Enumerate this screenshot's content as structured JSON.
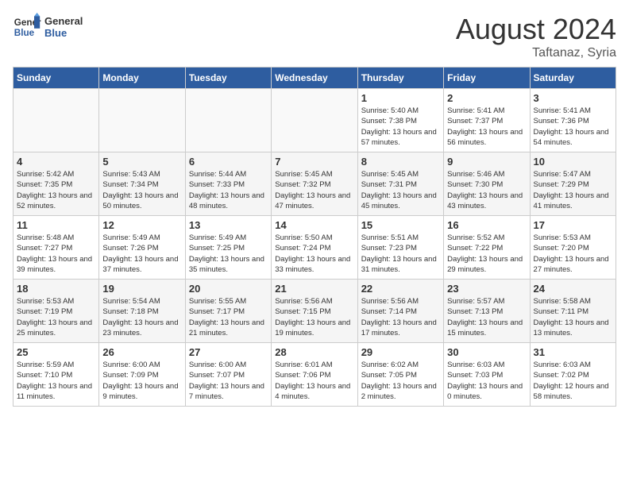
{
  "header": {
    "logo_line1": "General",
    "logo_line2": "Blue",
    "month_year": "August 2024",
    "location": "Taftanaz, Syria"
  },
  "weekdays": [
    "Sunday",
    "Monday",
    "Tuesday",
    "Wednesday",
    "Thursday",
    "Friday",
    "Saturday"
  ],
  "weeks": [
    [
      {
        "day": "",
        "empty": true
      },
      {
        "day": "",
        "empty": true
      },
      {
        "day": "",
        "empty": true
      },
      {
        "day": "",
        "empty": true
      },
      {
        "day": "1",
        "sunrise": "Sunrise: 5:40 AM",
        "sunset": "Sunset: 7:38 PM",
        "daylight": "Daylight: 13 hours and 57 minutes."
      },
      {
        "day": "2",
        "sunrise": "Sunrise: 5:41 AM",
        "sunset": "Sunset: 7:37 PM",
        "daylight": "Daylight: 13 hours and 56 minutes."
      },
      {
        "day": "3",
        "sunrise": "Sunrise: 5:41 AM",
        "sunset": "Sunset: 7:36 PM",
        "daylight": "Daylight: 13 hours and 54 minutes."
      }
    ],
    [
      {
        "day": "4",
        "sunrise": "Sunrise: 5:42 AM",
        "sunset": "Sunset: 7:35 PM",
        "daylight": "Daylight: 13 hours and 52 minutes."
      },
      {
        "day": "5",
        "sunrise": "Sunrise: 5:43 AM",
        "sunset": "Sunset: 7:34 PM",
        "daylight": "Daylight: 13 hours and 50 minutes."
      },
      {
        "day": "6",
        "sunrise": "Sunrise: 5:44 AM",
        "sunset": "Sunset: 7:33 PM",
        "daylight": "Daylight: 13 hours and 48 minutes."
      },
      {
        "day": "7",
        "sunrise": "Sunrise: 5:45 AM",
        "sunset": "Sunset: 7:32 PM",
        "daylight": "Daylight: 13 hours and 47 minutes."
      },
      {
        "day": "8",
        "sunrise": "Sunrise: 5:45 AM",
        "sunset": "Sunset: 7:31 PM",
        "daylight": "Daylight: 13 hours and 45 minutes."
      },
      {
        "day": "9",
        "sunrise": "Sunrise: 5:46 AM",
        "sunset": "Sunset: 7:30 PM",
        "daylight": "Daylight: 13 hours and 43 minutes."
      },
      {
        "day": "10",
        "sunrise": "Sunrise: 5:47 AM",
        "sunset": "Sunset: 7:29 PM",
        "daylight": "Daylight: 13 hours and 41 minutes."
      }
    ],
    [
      {
        "day": "11",
        "sunrise": "Sunrise: 5:48 AM",
        "sunset": "Sunset: 7:27 PM",
        "daylight": "Daylight: 13 hours and 39 minutes."
      },
      {
        "day": "12",
        "sunrise": "Sunrise: 5:49 AM",
        "sunset": "Sunset: 7:26 PM",
        "daylight": "Daylight: 13 hours and 37 minutes."
      },
      {
        "day": "13",
        "sunrise": "Sunrise: 5:49 AM",
        "sunset": "Sunset: 7:25 PM",
        "daylight": "Daylight: 13 hours and 35 minutes."
      },
      {
        "day": "14",
        "sunrise": "Sunrise: 5:50 AM",
        "sunset": "Sunset: 7:24 PM",
        "daylight": "Daylight: 13 hours and 33 minutes."
      },
      {
        "day": "15",
        "sunrise": "Sunrise: 5:51 AM",
        "sunset": "Sunset: 7:23 PM",
        "daylight": "Daylight: 13 hours and 31 minutes."
      },
      {
        "day": "16",
        "sunrise": "Sunrise: 5:52 AM",
        "sunset": "Sunset: 7:22 PM",
        "daylight": "Daylight: 13 hours and 29 minutes."
      },
      {
        "day": "17",
        "sunrise": "Sunrise: 5:53 AM",
        "sunset": "Sunset: 7:20 PM",
        "daylight": "Daylight: 13 hours and 27 minutes."
      }
    ],
    [
      {
        "day": "18",
        "sunrise": "Sunrise: 5:53 AM",
        "sunset": "Sunset: 7:19 PM",
        "daylight": "Daylight: 13 hours and 25 minutes."
      },
      {
        "day": "19",
        "sunrise": "Sunrise: 5:54 AM",
        "sunset": "Sunset: 7:18 PM",
        "daylight": "Daylight: 13 hours and 23 minutes."
      },
      {
        "day": "20",
        "sunrise": "Sunrise: 5:55 AM",
        "sunset": "Sunset: 7:17 PM",
        "daylight": "Daylight: 13 hours and 21 minutes."
      },
      {
        "day": "21",
        "sunrise": "Sunrise: 5:56 AM",
        "sunset": "Sunset: 7:15 PM",
        "daylight": "Daylight: 13 hours and 19 minutes."
      },
      {
        "day": "22",
        "sunrise": "Sunrise: 5:56 AM",
        "sunset": "Sunset: 7:14 PM",
        "daylight": "Daylight: 13 hours and 17 minutes."
      },
      {
        "day": "23",
        "sunrise": "Sunrise: 5:57 AM",
        "sunset": "Sunset: 7:13 PM",
        "daylight": "Daylight: 13 hours and 15 minutes."
      },
      {
        "day": "24",
        "sunrise": "Sunrise: 5:58 AM",
        "sunset": "Sunset: 7:11 PM",
        "daylight": "Daylight: 13 hours and 13 minutes."
      }
    ],
    [
      {
        "day": "25",
        "sunrise": "Sunrise: 5:59 AM",
        "sunset": "Sunset: 7:10 PM",
        "daylight": "Daylight: 13 hours and 11 minutes."
      },
      {
        "day": "26",
        "sunrise": "Sunrise: 6:00 AM",
        "sunset": "Sunset: 7:09 PM",
        "daylight": "Daylight: 13 hours and 9 minutes."
      },
      {
        "day": "27",
        "sunrise": "Sunrise: 6:00 AM",
        "sunset": "Sunset: 7:07 PM",
        "daylight": "Daylight: 13 hours and 7 minutes."
      },
      {
        "day": "28",
        "sunrise": "Sunrise: 6:01 AM",
        "sunset": "Sunset: 7:06 PM",
        "daylight": "Daylight: 13 hours and 4 minutes."
      },
      {
        "day": "29",
        "sunrise": "Sunrise: 6:02 AM",
        "sunset": "Sunset: 7:05 PM",
        "daylight": "Daylight: 13 hours and 2 minutes."
      },
      {
        "day": "30",
        "sunrise": "Sunrise: 6:03 AM",
        "sunset": "Sunset: 7:03 PM",
        "daylight": "Daylight: 13 hours and 0 minutes."
      },
      {
        "day": "31",
        "sunrise": "Sunrise: 6:03 AM",
        "sunset": "Sunset: 7:02 PM",
        "daylight": "Daylight: 12 hours and 58 minutes."
      }
    ]
  ]
}
